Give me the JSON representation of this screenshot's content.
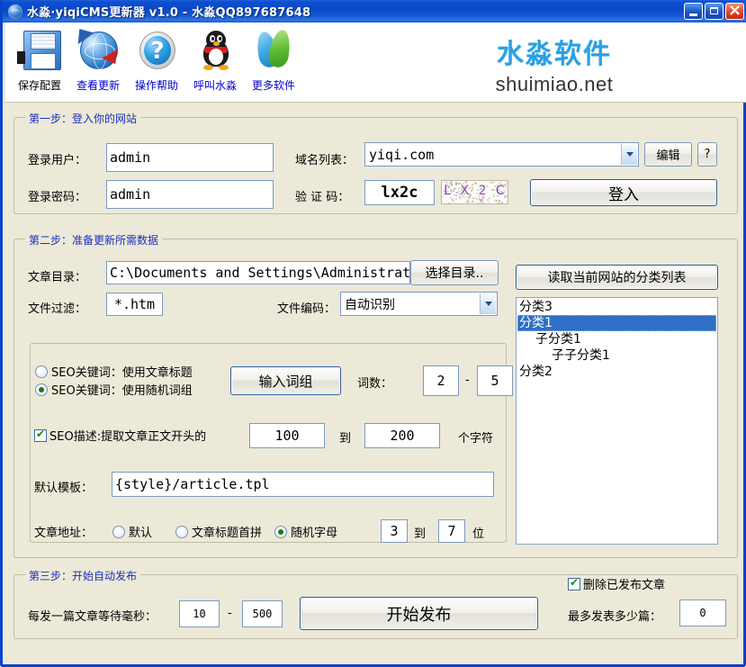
{
  "window": {
    "title": "水淼·yiqiCMS更新器 v1.0 - 水淼QQ897687648",
    "icon": "globe-icon",
    "minimize_label": "",
    "maximize_label": "",
    "close_label": ""
  },
  "toolbar": {
    "items": [
      {
        "label": "保存配置",
        "icon": "floppy-save-icon",
        "style": "plain"
      },
      {
        "label": "查看更新",
        "icon": "globe-refresh-icon",
        "style": "link"
      },
      {
        "label": "操作帮助",
        "icon": "question-help-icon",
        "style": "link"
      },
      {
        "label": "呼叫水淼",
        "icon": "qq-penguin-icon",
        "style": "link"
      },
      {
        "label": "更多软件",
        "icon": "water-drop-logo-icon",
        "style": "link"
      }
    ]
  },
  "brand": {
    "cn": "水淼软件",
    "en": "shuimiao.net",
    "accent_color": "#28A0E8"
  },
  "step1": {
    "title": "第一步：登入你的网站",
    "user_label": "登录用户：",
    "user_value": "admin",
    "password_label": "登录密码：",
    "password_value": "admin",
    "domain_label": "域名列表：",
    "domain_value": "yiqi.com",
    "edit_button": "编辑",
    "help_button": "?",
    "captcha_label": "验 证 码：",
    "captcha_value": "lx2c",
    "captcha_image_text": "L X 2 C",
    "login_button": "登入"
  },
  "step2": {
    "title": "第二步：准备更新所需数据",
    "dir_label": "文章目录：",
    "dir_value": "C:\\Documents and Settings\\Administrator\\桌",
    "choose_dir_button": "选择目录..",
    "filter_label": "文件过滤：",
    "filter_value": "*.htm",
    "encoding_label": "文件编码：",
    "encoding_value": "自动识别",
    "seo_kw_title_radio": "SEO关键词：使用文章标题",
    "seo_kw_random_radio": "SEO关键词：使用随机词组",
    "seo_kw_selected": "random",
    "input_words_button": "输入词组",
    "word_count_label": "词数：",
    "word_count_min": "2",
    "word_count_sep": "-",
    "word_count_max": "5",
    "seo_desc_check": "SEO描述:提取文章正文开头的",
    "seo_desc_checked": true,
    "seo_desc_min": "100",
    "seo_desc_to": "到",
    "seo_desc_max": "200",
    "seo_desc_unit": "个字符",
    "template_label": "默认模板：",
    "template_value": "{style}/article.tpl",
    "url_label": "文章地址：",
    "url_opt_default": "默认",
    "url_opt_pinyin": "文章标题首拼",
    "url_opt_random": "随机字母",
    "url_selected": "random",
    "url_len_min": "3",
    "url_len_to": "到",
    "url_len_max": "7",
    "url_len_unit": "位",
    "read_categories_button": "读取当前网站的分类列表",
    "categories": [
      {
        "label": "分类3",
        "indent": 0,
        "selected": false
      },
      {
        "label": "分类1",
        "indent": 0,
        "selected": true
      },
      {
        "label": "子分类1",
        "indent": 1,
        "selected": false
      },
      {
        "label": "子子分类1",
        "indent": 2,
        "selected": false
      },
      {
        "label": "分类2",
        "indent": 0,
        "selected": false
      }
    ]
  },
  "step3": {
    "title": "第三步：开始自动发布",
    "wait_label": "每发一篇文章等待毫秒：",
    "wait_min": "10",
    "wait_sep": "-",
    "wait_max": "500",
    "start_button": "开始发布",
    "delete_check": "删除已发布文章",
    "delete_checked": true,
    "max_label": "最多发表多少篇：",
    "max_value": "0"
  }
}
